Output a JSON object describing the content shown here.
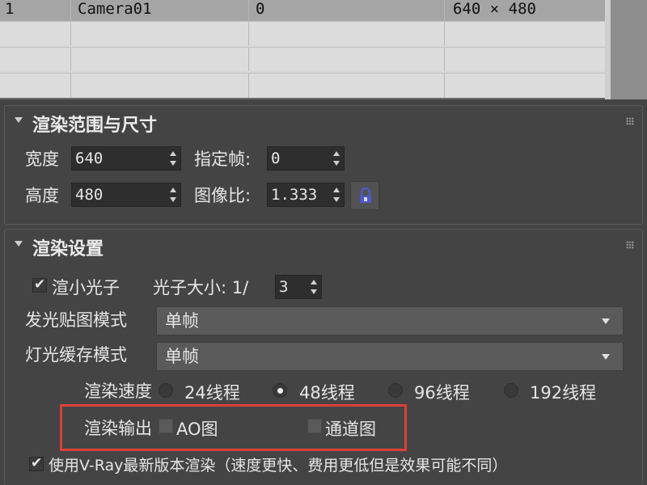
{
  "camera_table": {
    "selected_row": {
      "index": "1",
      "name": "Camera01",
      "frame": "0",
      "size": "640 × 480"
    },
    "empty_rows": 3
  },
  "render_range": {
    "title": "渲染范围与尺寸",
    "width_label": "宽度",
    "width_value": "640",
    "frame_label": "指定帧:",
    "frame_value": "0",
    "height_label": "高度",
    "height_value": "480",
    "aspect_label": "图像比:",
    "aspect_value": "1.333"
  },
  "render_settings": {
    "title": "渲染设置",
    "small_photon_label": "渲小光子",
    "small_photon_checked": true,
    "photon_size_label": "光子大小: 1/",
    "photon_size_value": "3",
    "glow_map_label": "发光贴图模式",
    "glow_map_value": "单帧",
    "light_cache_label": "灯光缓存模式",
    "light_cache_value": "单帧",
    "speed_label": "渲染速度",
    "threads": [
      {
        "label": "24线程",
        "selected": false
      },
      {
        "label": "48线程",
        "selected": true
      },
      {
        "label": "96线程",
        "selected": false
      },
      {
        "label": "192线程",
        "selected": false
      }
    ],
    "output_label": "渲染输出",
    "ao_label": "AO图",
    "channel_label": "通道图",
    "latest_vray_label": "使用V-Ray最新版本渲染（速度更快、费用更低但是效果可能不同）",
    "latest_vray_checked": true
  },
  "colors": {
    "panel_bg": "#444444",
    "highlight": "#d9403a"
  }
}
